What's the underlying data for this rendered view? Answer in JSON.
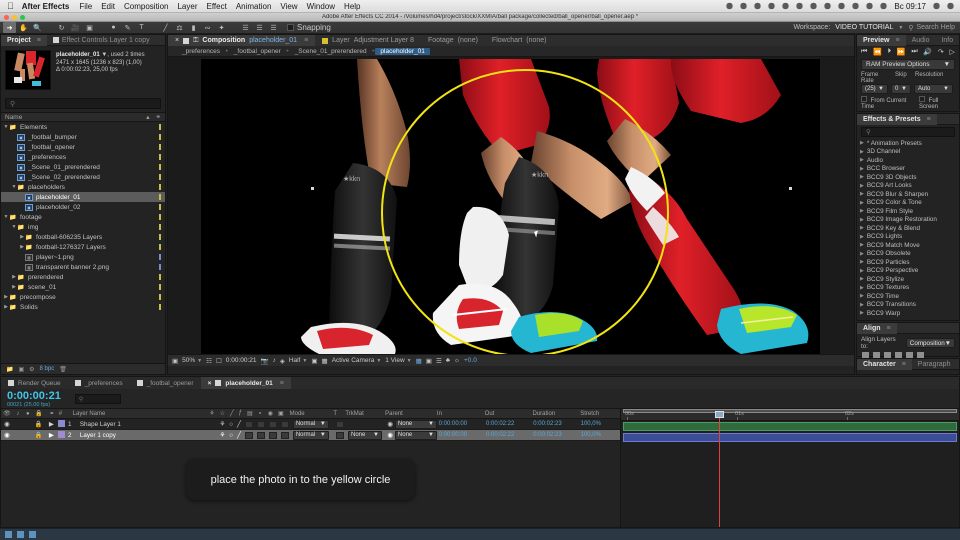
{
  "os_menu": {
    "apple_icon": "apple-icon",
    "app_name": "After Effects",
    "items": [
      "File",
      "Edit",
      "Composition",
      "Layer",
      "Effect",
      "Animation",
      "View",
      "Window",
      "Help"
    ],
    "clock": "Bc 09:17",
    "status_icons": [
      "dropbox-icon",
      "cloud-icon",
      "at-icon",
      "tag-icon",
      "bluetooth-icon",
      "wifi-icon",
      "screen-icon",
      "info-icon",
      "time-icon",
      "transfer-icon",
      "moon-icon",
      "volume-icon",
      "battery-icon",
      "flag-icon",
      "spotlight-icon",
      "notification-icon"
    ]
  },
  "titlebar": {
    "path": "Adobe After Effects CC 2014 - /Volumes/hd4/project/stock/XXMIA/ball package/collected/ball_opener/ball_opener.aep *"
  },
  "toolbar": {
    "tools": [
      "selection-tool",
      "hand-tool",
      "zoom-tool",
      "rotation-tool",
      "camera-tool",
      "pan-behind-tool",
      "shape-tool",
      "pen-tool",
      "text-tool",
      "brush-tool",
      "clone-stamp-tool",
      "eraser-tool",
      "roto-brush-tool",
      "puppet-pin-tool"
    ],
    "selected_tool": "selection-tool",
    "snapping_label": "Snapping",
    "workspace_label": "Workspace:",
    "workspace_value": "VIDEO TUTORIAL",
    "search_help": "Search Help"
  },
  "project_panel": {
    "tabs": [
      {
        "label": "Project",
        "active": true
      },
      {
        "label": "Effect Controls Layer 1 copy",
        "active": false
      }
    ],
    "selected_item": {
      "name": "placeholder_01",
      "usage": ", used 2 times",
      "dimensions": "2471 x 1645  (1236 x 823) (1,00)",
      "duration": "Δ 0:00:02:23, 25,00 fps"
    },
    "search_placeholder": "",
    "column_header": "Name",
    "tree": [
      {
        "label": "Elements",
        "type": "folder",
        "depth": 0,
        "twirl": "open",
        "tag": "yellow"
      },
      {
        "label": "_footbal_bumper",
        "type": "comp",
        "depth": 1,
        "tag": "yellow"
      },
      {
        "label": "_footbal_opener",
        "type": "comp",
        "depth": 1,
        "tag": "yellow"
      },
      {
        "label": "_preferences",
        "type": "comp",
        "depth": 1,
        "tag": "yellow"
      },
      {
        "label": "_Scene_01_prerendered",
        "type": "comp",
        "depth": 1,
        "tag": "yellow"
      },
      {
        "label": "_Scene_02_prerendered",
        "type": "comp",
        "depth": 1,
        "tag": "yellow"
      },
      {
        "label": "placeholders",
        "type": "folder",
        "depth": 1,
        "twirl": "open",
        "tag": "yellow"
      },
      {
        "label": "placeholder_01",
        "type": "comp",
        "depth": 2,
        "selected": true,
        "tag": "yellow"
      },
      {
        "label": "placeholder_02",
        "type": "comp",
        "depth": 2,
        "tag": "yellow"
      },
      {
        "label": "footage",
        "type": "folder",
        "depth": 0,
        "twirl": "open",
        "tag": "yellow"
      },
      {
        "label": "img",
        "type": "folder",
        "depth": 1,
        "twirl": "open",
        "tag": "yellow"
      },
      {
        "label": "football-606235 Layers",
        "type": "folder",
        "depth": 2,
        "twirl": "closed",
        "tag": "yellow"
      },
      {
        "label": "football-1276327 Layers",
        "type": "folder",
        "depth": 2,
        "twirl": "closed",
        "tag": "yellow"
      },
      {
        "label": "player~1.png",
        "type": "png",
        "depth": 2,
        "tag": "blue"
      },
      {
        "label": "transparent banner 2.png",
        "type": "png",
        "depth": 2,
        "tag": "blue"
      },
      {
        "label": "prerendered",
        "type": "folder",
        "depth": 1,
        "twirl": "closed",
        "tag": "yellow"
      },
      {
        "label": "scene_01",
        "type": "folder",
        "depth": 1,
        "twirl": "closed",
        "tag": "yellow"
      },
      {
        "label": "precompose",
        "type": "folder",
        "depth": 0,
        "twirl": "closed",
        "tag": "yellow"
      },
      {
        "label": "Solids",
        "type": "folder",
        "depth": 0,
        "twirl": "closed",
        "tag": "yellow"
      }
    ],
    "footer": {
      "bpc": "8 bpc"
    }
  },
  "comp_panel": {
    "viewer_tabs": [
      {
        "type": "Composition",
        "name": "placeholder_01",
        "active": true
      },
      {
        "type": "Layer",
        "name": "Adjustment Layer 8",
        "active": false
      },
      {
        "type": "Footage",
        "name": "(none)",
        "active": false
      },
      {
        "type": "Flowchart",
        "name": "(none)",
        "active": false
      }
    ],
    "breadcrumbs": [
      {
        "label": "_preferences",
        "active": false
      },
      {
        "label": "_footbal_opener",
        "active": false
      },
      {
        "label": "_Scene_01_prerendered",
        "active": false
      },
      {
        "label": "placeholder_01",
        "active": true
      }
    ],
    "footer": {
      "zoom": "50%",
      "timecode": "0:00:00:21",
      "resolution": "Half",
      "camera": "Active Camera",
      "views": "1 View",
      "exposure": "+0.0"
    }
  },
  "preview_panel": {
    "tabs": [
      {
        "label": "Preview",
        "active": true
      },
      {
        "label": "Audio",
        "active": false
      },
      {
        "label": "Info",
        "active": false
      }
    ],
    "transport": [
      "first-frame-icon",
      "prev-frame-icon",
      "play-icon",
      "next-frame-icon",
      "last-frame-icon",
      "audio-icon",
      "loop-icon",
      "ram-preview-icon"
    ],
    "ram_preview_options": "RAM Preview Options",
    "labels": {
      "frame_rate": "Frame Rate",
      "skip": "Skip",
      "resolution": "Resolution"
    },
    "values": {
      "frame_rate": "(25)",
      "skip": "0",
      "resolution": "Auto"
    },
    "checkboxes": [
      {
        "label": "From Current Time",
        "checked": false
      },
      {
        "label": "Full Screen",
        "checked": false
      }
    ]
  },
  "effects_panel": {
    "tab": "Effects & Presets",
    "search_placeholder": "",
    "items": [
      "* Animation Presets",
      "3D Channel",
      "Audio",
      "BCC Browser",
      "BCC9 3D Objects",
      "BCC9 Art Looks",
      "BCC9 Blur & Sharpen",
      "BCC9 Color & Tone",
      "BCC9 Film Style",
      "BCC9 Image Restoration",
      "BCC9 Key & Blend",
      "BCC9 Lights",
      "BCC9 Match Move",
      "BCC9 Obsolete",
      "BCC9 Particles",
      "BCC9 Perspective",
      "BCC9 Stylize",
      "BCC9 Textures",
      "BCC9 Time",
      "BCC9 Transitions",
      "BCC9 Warp"
    ]
  },
  "align_panel": {
    "tab": "Align",
    "align_layers_to_label": "Align Layers to:",
    "align_layers_to_value": "Composition"
  },
  "character_panel": {
    "tabs": [
      {
        "label": "Character",
        "active": true
      },
      {
        "label": "Paragraph",
        "active": false
      }
    ]
  },
  "timeline": {
    "tabs": [
      {
        "label": "Render Queue",
        "active": false
      },
      {
        "label": "_preferences",
        "active": false
      },
      {
        "label": "_footbal_opener",
        "active": false
      },
      {
        "label": "placeholder_01",
        "active": true
      }
    ],
    "current_time": "0:00:00:21",
    "current_frame": "00021 (25.00 fps)",
    "columns": [
      "Layer Name",
      "Mode",
      "T",
      "TrkMat",
      "Parent",
      "In",
      "Out",
      "Duration",
      "Stretch"
    ],
    "layers": [
      {
        "index": "1",
        "name": "Shape Layer 1",
        "mode": "Normal",
        "trkmat": "",
        "parent": "None",
        "in": "0:00:00:00",
        "out": "0:00:02:22",
        "duration": "0:00:02:23",
        "stretch": "100,0%",
        "color": "#8a8ad0",
        "bar": "green",
        "selected": false
      },
      {
        "index": "2",
        "name": "Layer 1 copy",
        "mode": "Normal",
        "trkmat": "None",
        "parent": "None",
        "in": "0:00:00:00",
        "out": "0:00:02:22",
        "duration": "0:00:02:23",
        "stretch": "100,0%",
        "color": "#a08ad0",
        "bar": "blue",
        "selected": true
      }
    ],
    "ruler_ticks": [
      "00s",
      "01s",
      "02s"
    ]
  },
  "caption": {
    "text": "place the photo in to the yellow circle"
  },
  "colors": {
    "accent_yellow": "#f2e313",
    "timecode_blue": "#3fc4e8",
    "selection_blue": "#2f5d86"
  }
}
